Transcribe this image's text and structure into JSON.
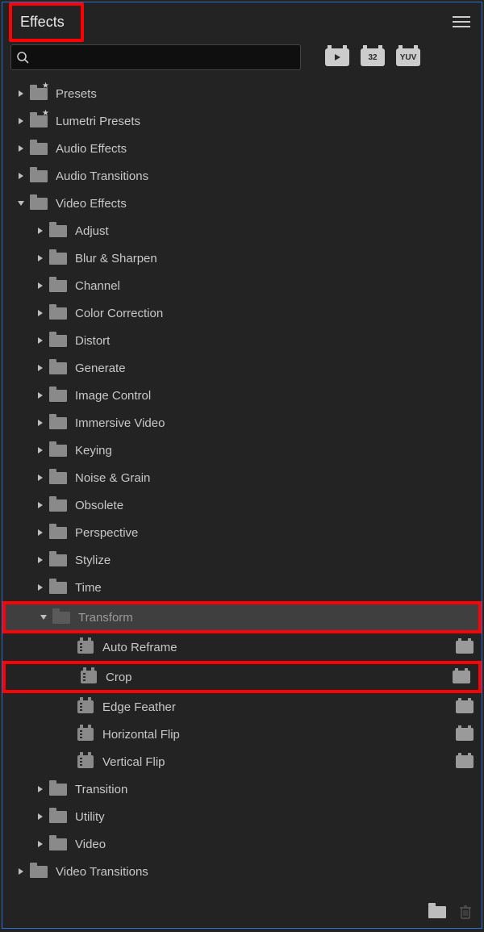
{
  "header": {
    "title": "Effects"
  },
  "search": {
    "placeholder": ""
  },
  "badges": [
    "",
    "32",
    "YUV"
  ],
  "tree": [
    {
      "label": "Presets",
      "depth": 0,
      "expanded": false,
      "icon": "preset"
    },
    {
      "label": "Lumetri Presets",
      "depth": 0,
      "expanded": false,
      "icon": "preset"
    },
    {
      "label": "Audio Effects",
      "depth": 0,
      "expanded": false,
      "icon": "folder"
    },
    {
      "label": "Audio Transitions",
      "depth": 0,
      "expanded": false,
      "icon": "folder"
    },
    {
      "label": "Video Effects",
      "depth": 0,
      "expanded": true,
      "icon": "folder"
    },
    {
      "label": "Adjust",
      "depth": 1,
      "expanded": false,
      "icon": "folder"
    },
    {
      "label": "Blur & Sharpen",
      "depth": 1,
      "expanded": false,
      "icon": "folder"
    },
    {
      "label": "Channel",
      "depth": 1,
      "expanded": false,
      "icon": "folder"
    },
    {
      "label": "Color Correction",
      "depth": 1,
      "expanded": false,
      "icon": "folder"
    },
    {
      "label": "Distort",
      "depth": 1,
      "expanded": false,
      "icon": "folder"
    },
    {
      "label": "Generate",
      "depth": 1,
      "expanded": false,
      "icon": "folder"
    },
    {
      "label": "Image Control",
      "depth": 1,
      "expanded": false,
      "icon": "folder"
    },
    {
      "label": "Immersive Video",
      "depth": 1,
      "expanded": false,
      "icon": "folder"
    },
    {
      "label": "Keying",
      "depth": 1,
      "expanded": false,
      "icon": "folder"
    },
    {
      "label": "Noise & Grain",
      "depth": 1,
      "expanded": false,
      "icon": "folder"
    },
    {
      "label": "Obsolete",
      "depth": 1,
      "expanded": false,
      "icon": "folder"
    },
    {
      "label": "Perspective",
      "depth": 1,
      "expanded": false,
      "icon": "folder"
    },
    {
      "label": "Stylize",
      "depth": 1,
      "expanded": false,
      "icon": "folder"
    },
    {
      "label": "Time",
      "depth": 1,
      "expanded": false,
      "icon": "folder"
    },
    {
      "label": "Transform",
      "depth": 1,
      "expanded": true,
      "icon": "folder-dark",
      "selected": true,
      "highlight": true
    },
    {
      "label": "Auto Reframe",
      "depth": 2,
      "icon": "fx",
      "trailing": true
    },
    {
      "label": "Crop",
      "depth": 2,
      "icon": "fx",
      "trailing": true,
      "highlight": true
    },
    {
      "label": "Edge Feather",
      "depth": 2,
      "icon": "fx",
      "trailing": true
    },
    {
      "label": "Horizontal Flip",
      "depth": 2,
      "icon": "fx",
      "trailing": true
    },
    {
      "label": "Vertical Flip",
      "depth": 2,
      "icon": "fx",
      "trailing": true
    },
    {
      "label": "Transition",
      "depth": 1,
      "expanded": false,
      "icon": "folder"
    },
    {
      "label": "Utility",
      "depth": 1,
      "expanded": false,
      "icon": "folder"
    },
    {
      "label": "Video",
      "depth": 1,
      "expanded": false,
      "icon": "folder"
    },
    {
      "label": "Video Transitions",
      "depth": 0,
      "expanded": false,
      "icon": "folder"
    }
  ]
}
